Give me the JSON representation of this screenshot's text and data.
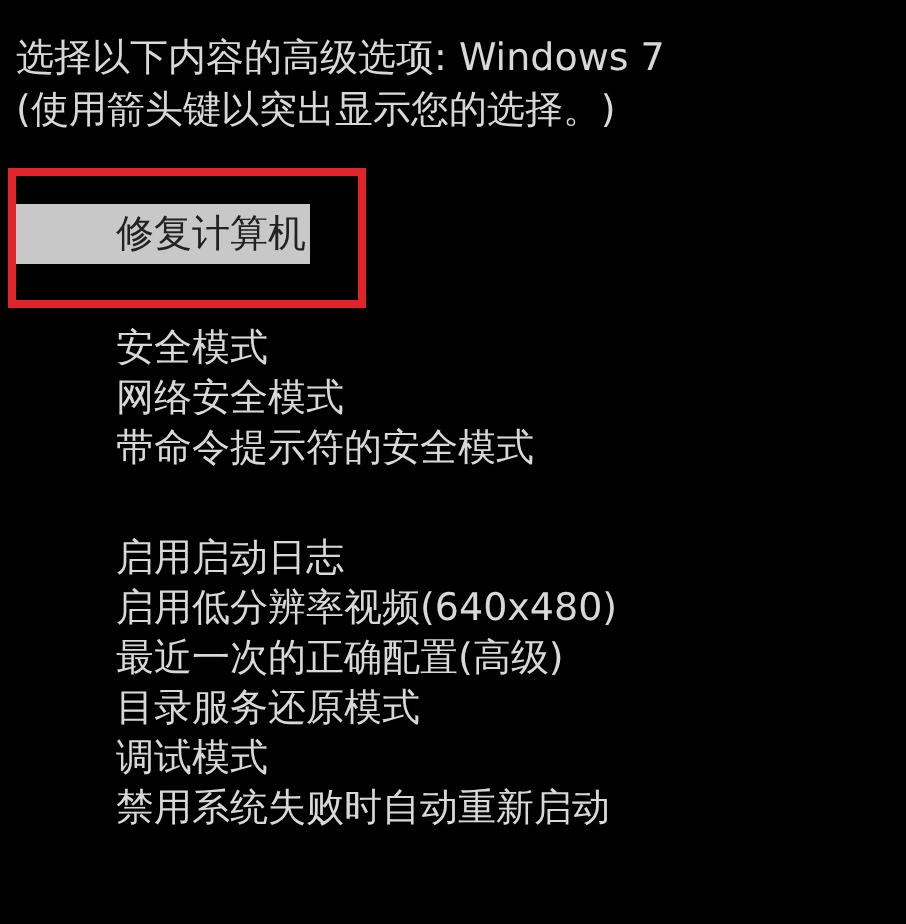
{
  "header": {
    "title": "选择以下内容的高级选项: Windows 7",
    "hint": "(使用箭头键以突出显示您的选择。)"
  },
  "menu_groups": [
    [
      {
        "label": "修复计算机",
        "selected": true,
        "highlighted": true
      }
    ],
    [
      {
        "label": "安全模式",
        "selected": false,
        "highlighted": false
      },
      {
        "label": "网络安全模式",
        "selected": false,
        "highlighted": false
      },
      {
        "label": "带命令提示符的安全模式",
        "selected": false,
        "highlighted": false
      }
    ],
    [
      {
        "label": "启用启动日志",
        "selected": false,
        "highlighted": false
      },
      {
        "label": "启用低分辨率视频(640x480)",
        "selected": false,
        "highlighted": false
      },
      {
        "label": "最近一次的正确配置(高级)",
        "selected": false,
        "highlighted": false
      },
      {
        "label": "目录服务还原模式",
        "selected": false,
        "highlighted": false
      },
      {
        "label": "调试模式",
        "selected": false,
        "highlighted": false
      },
      {
        "label": "禁用系统失败时自动重新启动",
        "selected": false,
        "highlighted": false
      }
    ]
  ]
}
